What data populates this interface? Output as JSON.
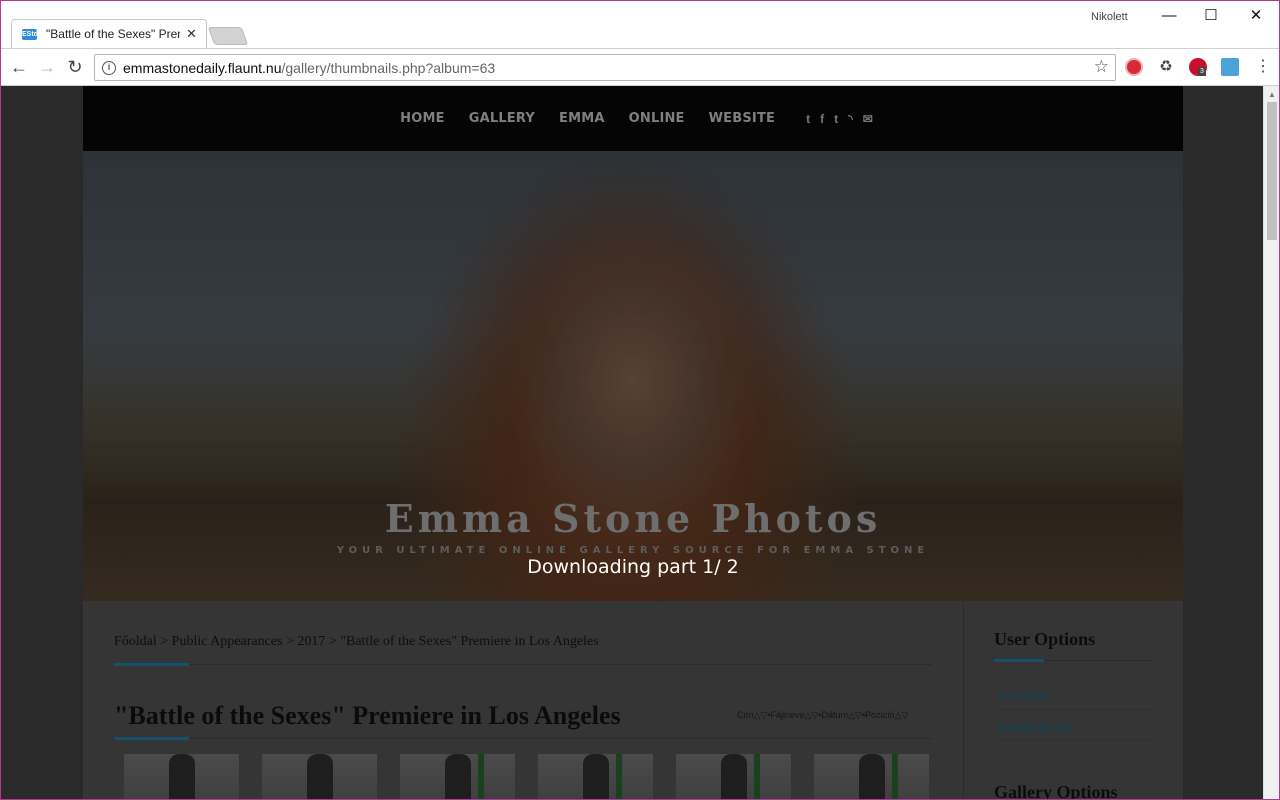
{
  "browser": {
    "tab_title": "\"Battle of the Sexes\" Prem",
    "tab_favicon_text": "EStd",
    "user_label": "Nikolett",
    "url_host": "emmastonedaily.flaunt.nu",
    "url_path": "/gallery/thumbnails.php?album=63",
    "extension_badge": "3"
  },
  "site": {
    "nav": [
      "HOME",
      "GALLERY",
      "EMMA",
      "ONLINE",
      "WEBSITE"
    ],
    "social_icons": [
      "twitter-icon",
      "facebook-icon",
      "tumblr-icon",
      "rss-icon",
      "mail-icon"
    ],
    "hero_title": "Emma Stone Photos",
    "hero_subtitle": "YOUR ULTIMATE ONLINE GALLERY SOURCE FOR EMMA STONE",
    "overlay_text": "Downloading part 1/ 2"
  },
  "content": {
    "breadcrumb": "Főoldal > Public Appearances > 2017 > \"Battle of the Sexes\" Premiere in Los Angeles",
    "album_title": "\"Battle of the Sexes\" Premiere in Los Angeles",
    "sort_controls": "Cím△▽•Fájlneve△▽•Dátum△▽•Pozíció△▽"
  },
  "sidebar": {
    "user_options_title": "User Options",
    "links": [
      "Kezdőlap",
      "Bejelentkezés"
    ],
    "gallery_options_title": "Gallery Options"
  },
  "colors": {
    "accent": "#16506c",
    "window_border": "#b4359c"
  }
}
